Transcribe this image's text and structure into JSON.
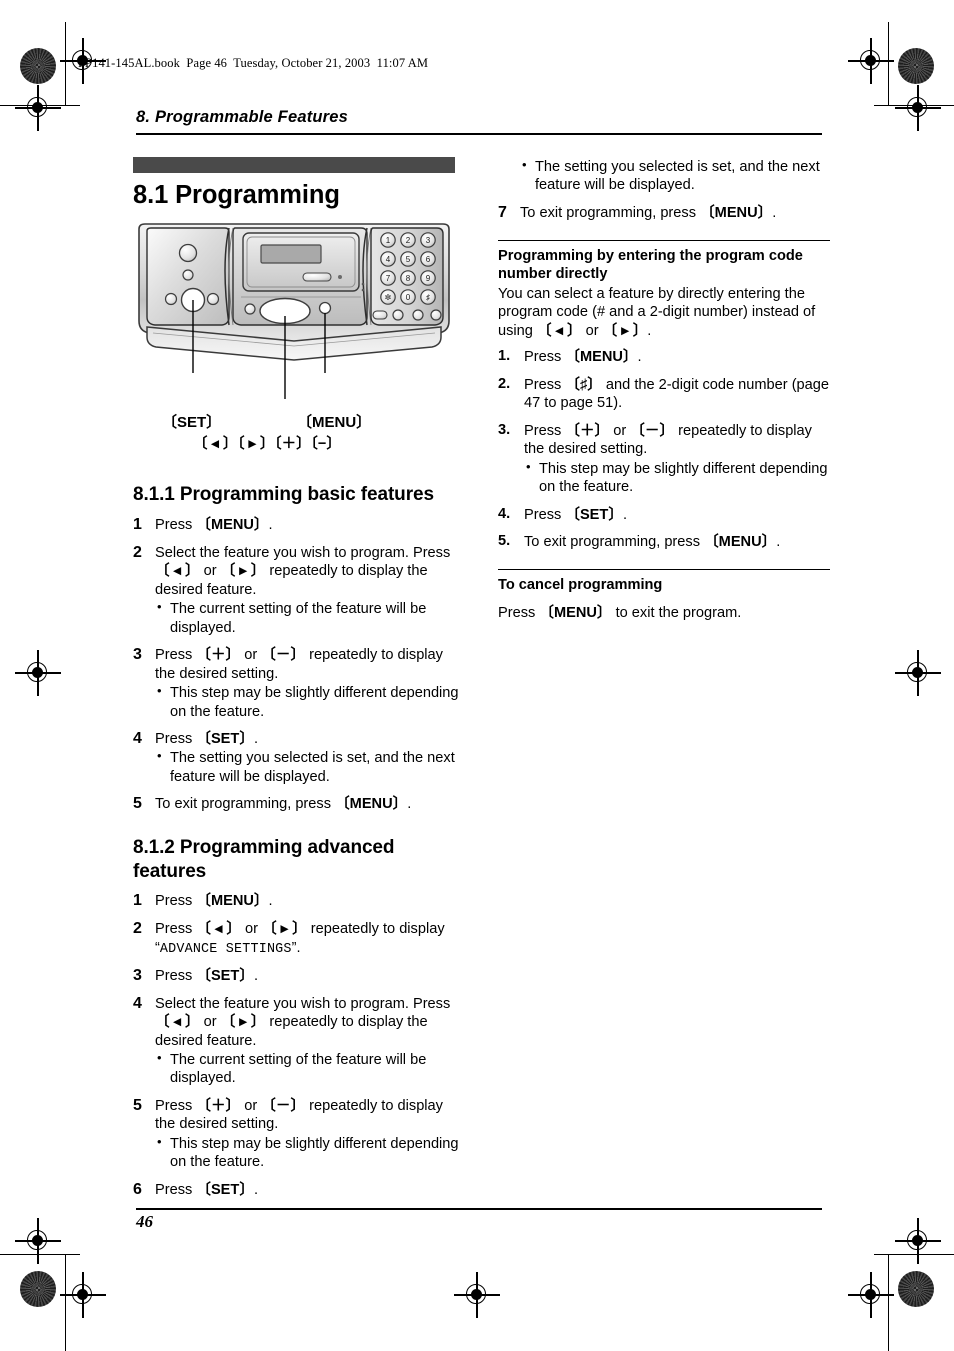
{
  "document": {
    "file_header": "FP141-145AL.book  Page 46  Tuesday, October 21, 2003  11:07 AM",
    "chapter_title": "8. Programmable Features",
    "page_number": "46"
  },
  "section": {
    "title": "8.1 Programming",
    "banner_color": "#4a4a4a"
  },
  "figure": {
    "caption_set": "〔SET〕",
    "caption_menu": "〔MENU〕",
    "caption_arrows": "〔 ◂ 〕〔 ▸ 〕〔＋〕〔−〕",
    "keypad_keys": [
      "1",
      "2",
      "3",
      "4",
      "5",
      "6",
      "7",
      "8",
      "9",
      "∗",
      "0",
      "♯"
    ]
  },
  "basic": {
    "heading": "8.1.1 Programming basic features",
    "steps": [
      {
        "num": "1",
        "lines": [
          "Press 〔MENU〕."
        ],
        "bullets": []
      },
      {
        "num": "2",
        "lines": [
          "Select the feature you wish to program.",
          "Press 〔 ◂ 〕 or 〔 ▸ 〕 repeatedly to display the desired feature."
        ],
        "bullets": [
          "The current setting of the feature will be displayed."
        ]
      },
      {
        "num": "3",
        "lines": [
          "Press 〔＋〕 or 〔−〕 repeatedly to display the desired setting."
        ],
        "bullets": [
          "This step may be slightly different depending on the feature."
        ]
      },
      {
        "num": "4",
        "lines": [
          "Press 〔SET〕."
        ],
        "bullets": [
          "The setting you selected is set, and the next feature will be displayed."
        ]
      },
      {
        "num": "5",
        "lines": [
          "To exit programming, press 〔MENU〕."
        ],
        "bullets": []
      }
    ]
  },
  "advanced": {
    "heading": "8.1.2 Programming advanced features",
    "steps": [
      {
        "num": "1",
        "lines": [
          "Press 〔MENU〕."
        ],
        "bullets": []
      },
      {
        "num": "2",
        "lines": [
          "Press 〔 ◂ 〕 or 〔 ▸ 〕 repeatedly to display"
        ],
        "lcd": "ADVANCE SETTINGS",
        "bullets": []
      },
      {
        "num": "3",
        "lines": [
          "Press 〔SET〕."
        ],
        "bullets": []
      },
      {
        "num": "4",
        "lines": [
          "Select the feature you wish to program.",
          "Press 〔 ◂ 〕 or 〔 ▸ 〕 repeatedly to display the desired feature."
        ],
        "bullets": [
          "The current setting of the feature will be displayed."
        ]
      },
      {
        "num": "5",
        "lines": [
          "Press 〔＋〕 or 〔−〕 repeatedly to display the desired setting."
        ],
        "bullets": [
          "This step may be slightly different depending on the feature."
        ]
      },
      {
        "num": "6",
        "lines": [
          "Press 〔SET〕."
        ],
        "bullets": [
          "The setting you selected is set, and the next feature will be displayed."
        ]
      },
      {
        "num": "7",
        "lines": [
          "To exit programming, press 〔MENU〕."
        ],
        "bullets": []
      }
    ]
  },
  "direct_code": {
    "heading": "Programming by entering the program code number directly",
    "intro": "You can select a feature by directly entering the program code (# and a 2-digit number) instead of using 〔 ◂ 〕 or 〔 ▸ 〕.",
    "steps": [
      {
        "num": "1.",
        "lines": [
          "Press 〔MENU〕."
        ],
        "bullets": []
      },
      {
        "num": "2.",
        "lines": [
          "Press 〔♯〕 and the 2-digit code number (page 47 to page 51)."
        ],
        "bullets": []
      },
      {
        "num": "3.",
        "lines": [
          "Press 〔＋〕 or 〔−〕 repeatedly to display the desired setting."
        ],
        "bullets": [
          "This step may be slightly different depending on the feature."
        ]
      },
      {
        "num": "4.",
        "lines": [
          "Press 〔SET〕."
        ],
        "bullets": []
      },
      {
        "num": "5.",
        "lines": [
          "To exit programming, press 〔MENU〕."
        ],
        "bullets": []
      }
    ]
  },
  "cancel": {
    "heading": "To cancel programming",
    "text": "Press 〔MENU〕 to exit the program."
  }
}
